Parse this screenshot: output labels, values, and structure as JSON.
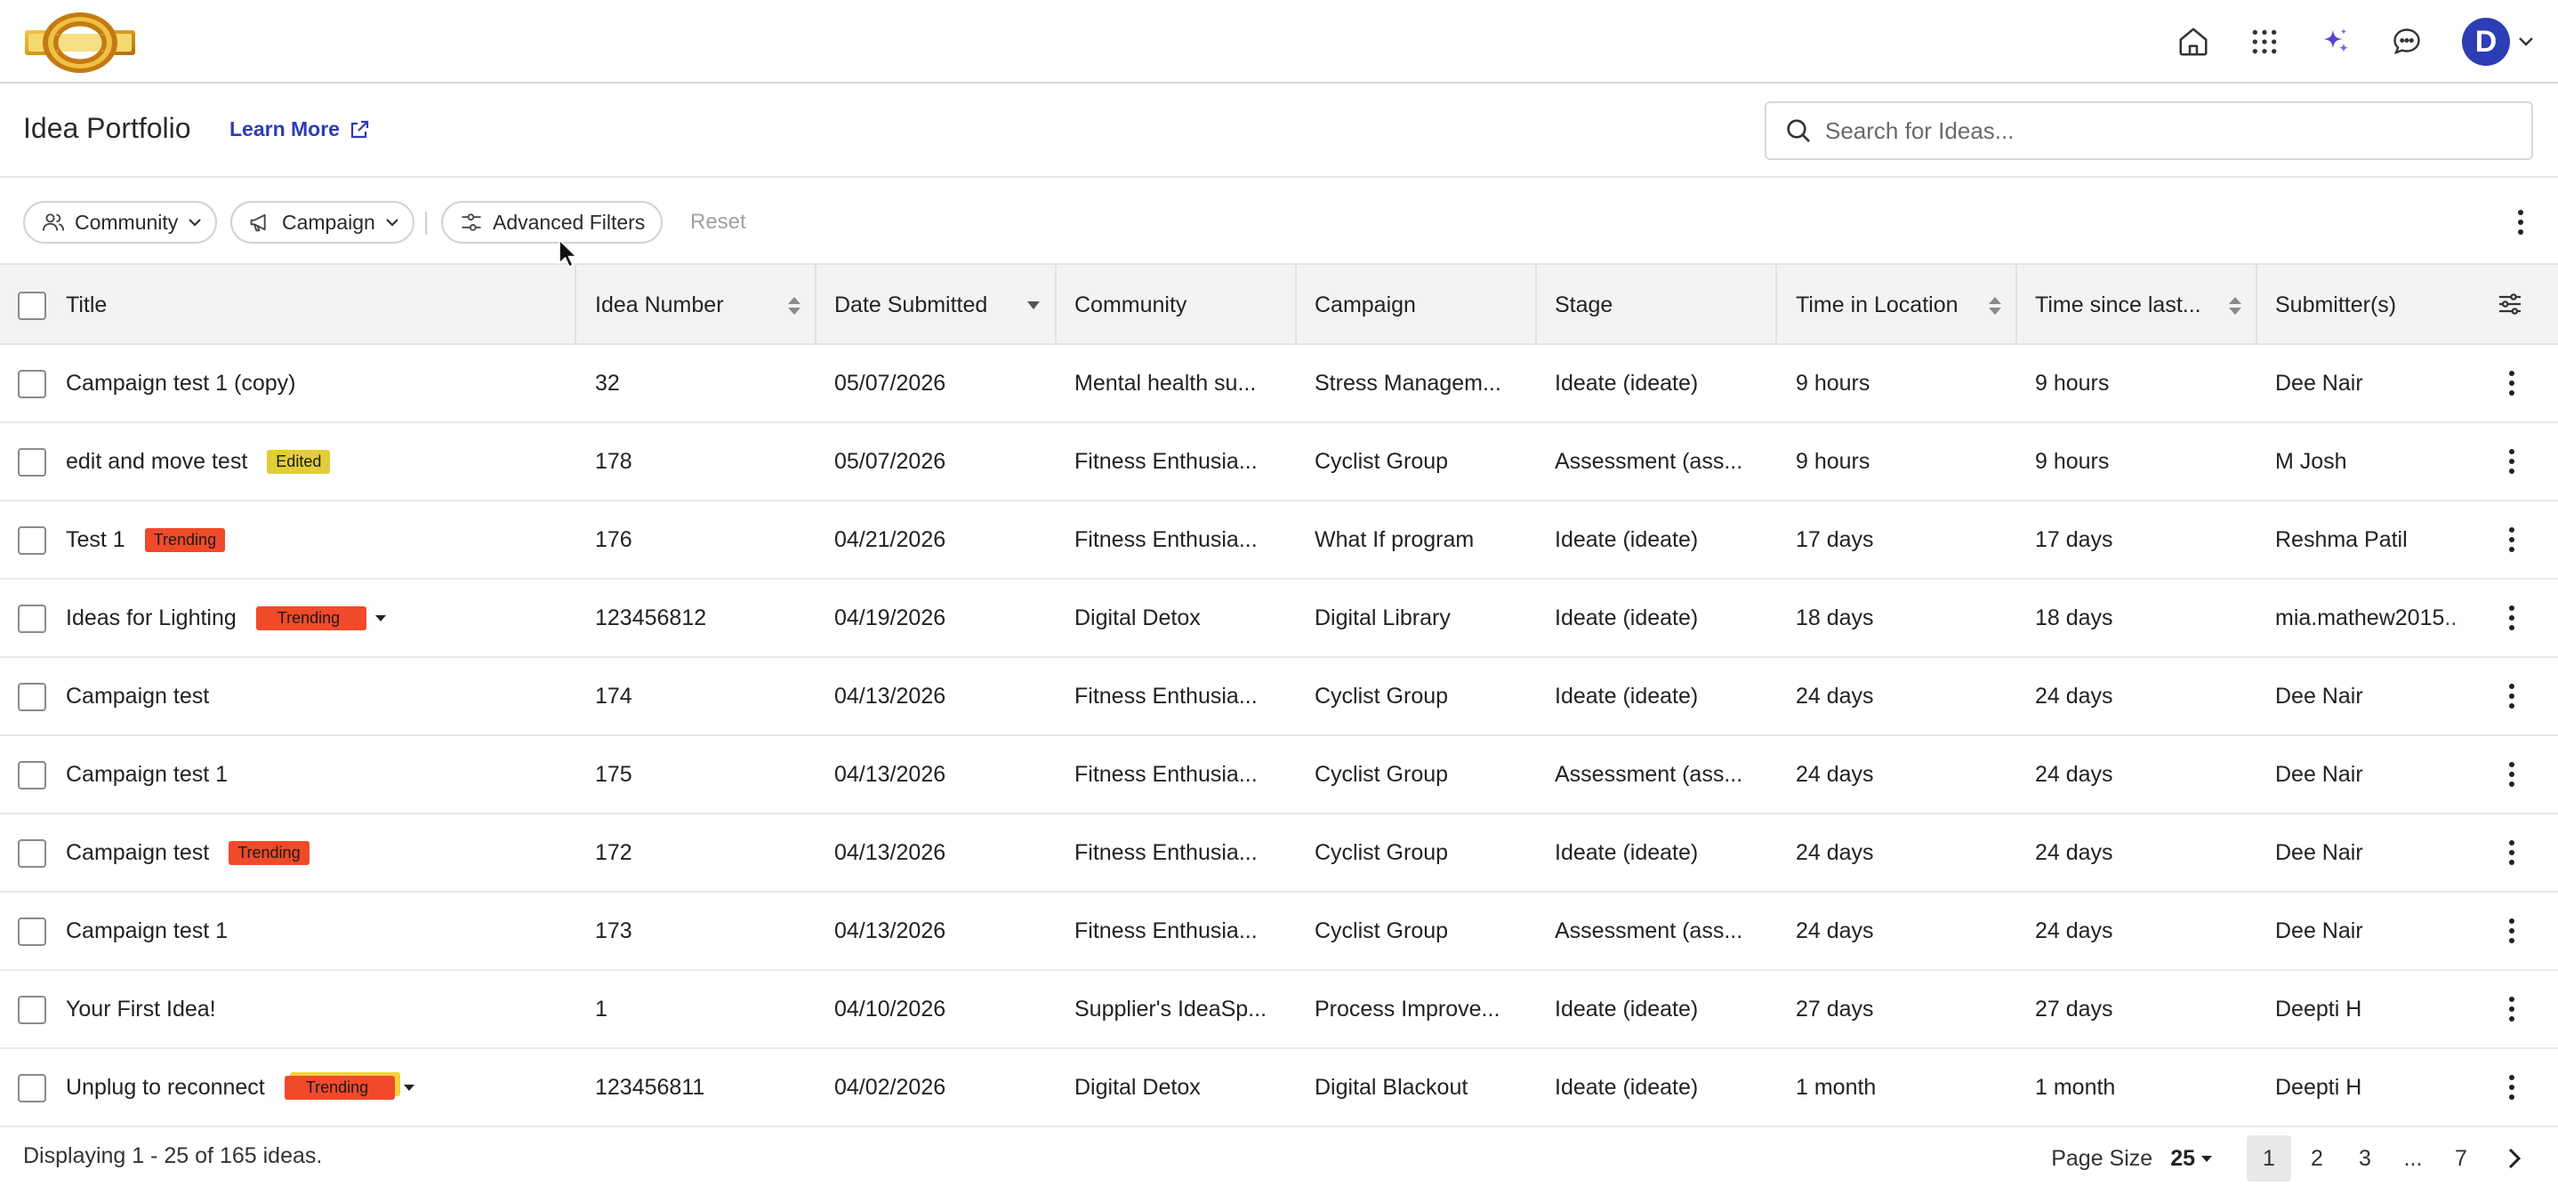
{
  "header": {
    "page_title": "Idea Portfolio",
    "learn_more": "Learn More"
  },
  "search": {
    "placeholder": "Search for Ideas..."
  },
  "user": {
    "avatar_initial": "D"
  },
  "filters": {
    "community": "Community",
    "campaign": "Campaign",
    "advanced": "Advanced Filters",
    "reset": "Reset"
  },
  "columns": {
    "title": "Title",
    "idea_number": "Idea Number",
    "date_submitted": "Date Submitted",
    "community": "Community",
    "campaign": "Campaign",
    "stage": "Stage",
    "time_in_location": "Time in Location",
    "time_since_last": "Time since last...",
    "submitters": "Submitter(s)"
  },
  "rows": [
    {
      "title": "Campaign test 1 (copy)",
      "badge": "",
      "idea_number": "32",
      "date": "05/07/2026",
      "community": "Mental health su...",
      "campaign": "Stress Managem...",
      "stage": "Ideate (ideate)",
      "time_in_location": "9 hours",
      "time_since": "9 hours",
      "submitter": "Dee Nair"
    },
    {
      "title": "edit and move test",
      "badge": "Edited",
      "idea_number": "178",
      "date": "05/07/2026",
      "community": "Fitness Enthusia...",
      "campaign": "Cyclist Group",
      "stage": "Assessment (ass...",
      "time_in_location": "9 hours",
      "time_since": "9 hours",
      "submitter": "M Josh"
    },
    {
      "title": "Test 1",
      "badge": "Trending",
      "idea_number": "176",
      "date": "04/21/2026",
      "community": "Fitness Enthusia...",
      "campaign": "What If program",
      "stage": "Ideate (ideate)",
      "time_in_location": "17 days",
      "time_since": "17 days",
      "submitter": "Reshma Patil"
    },
    {
      "title": "Ideas for Lighting",
      "badge": "Trending",
      "idea_number": "123456812",
      "date": "04/19/2026",
      "community": "Digital Detox",
      "campaign": "Digital Library",
      "stage": "Ideate (ideate)",
      "time_in_location": "18 days",
      "time_since": "18 days",
      "submitter": "mia.mathew2015",
      "submitter_more": ".."
    },
    {
      "title": "Campaign test",
      "badge": "",
      "idea_number": "174",
      "date": "04/13/2026",
      "community": "Fitness Enthusia...",
      "campaign": "Cyclist Group",
      "stage": "Ideate (ideate)",
      "time_in_location": "24 days",
      "time_since": "24 days",
      "submitter": "Dee Nair"
    },
    {
      "title": "Campaign test 1",
      "badge": "",
      "idea_number": "175",
      "date": "04/13/2026",
      "community": "Fitness Enthusia...",
      "campaign": "Cyclist Group",
      "stage": "Assessment (ass...",
      "time_in_location": "24 days",
      "time_since": "24 days",
      "submitter": "Dee Nair"
    },
    {
      "title": "Campaign test",
      "badge": "Trending",
      "idea_number": "172",
      "date": "04/13/2026",
      "community": "Fitness Enthusia...",
      "campaign": "Cyclist Group",
      "stage": "Ideate (ideate)",
      "time_in_location": "24 days",
      "time_since": "24 days",
      "submitter": "Dee Nair"
    },
    {
      "title": "Campaign test 1",
      "badge": "",
      "idea_number": "173",
      "date": "04/13/2026",
      "community": "Fitness Enthusia...",
      "campaign": "Cyclist Group",
      "stage": "Assessment (ass...",
      "time_in_location": "24 days",
      "time_since": "24 days",
      "submitter": "Dee Nair"
    },
    {
      "title": "Your First Idea!",
      "badge": "",
      "idea_number": "1",
      "date": "04/10/2026",
      "community": "Supplier's IdeaSp...",
      "campaign": "Process Improve...",
      "stage": "Ideate (ideate)",
      "time_in_location": "27 days",
      "time_since": "27 days",
      "submitter": "Deepti H"
    },
    {
      "title": "Unplug to reconnect",
      "badge": "Trending",
      "idea_number": "123456811",
      "date": "04/02/2026",
      "community": "Digital Detox",
      "campaign": "Digital Blackout",
      "stage": "Ideate (ideate)",
      "time_in_location": "1 month",
      "time_since": "1 month",
      "submitter": "Deepti H"
    }
  ],
  "footer": {
    "displaying": "Displaying 1 - 25 of 165 ideas.",
    "page_size_label": "Page Size",
    "page_size": "25",
    "pages": [
      "1",
      "2",
      "3",
      "...",
      "7"
    ],
    "current_page": "1"
  },
  "colors": {
    "accent": "#2d3db5",
    "trending": "#f04a2a",
    "edited": "#e2cd3a",
    "header_bg": "#f3f3f3"
  }
}
